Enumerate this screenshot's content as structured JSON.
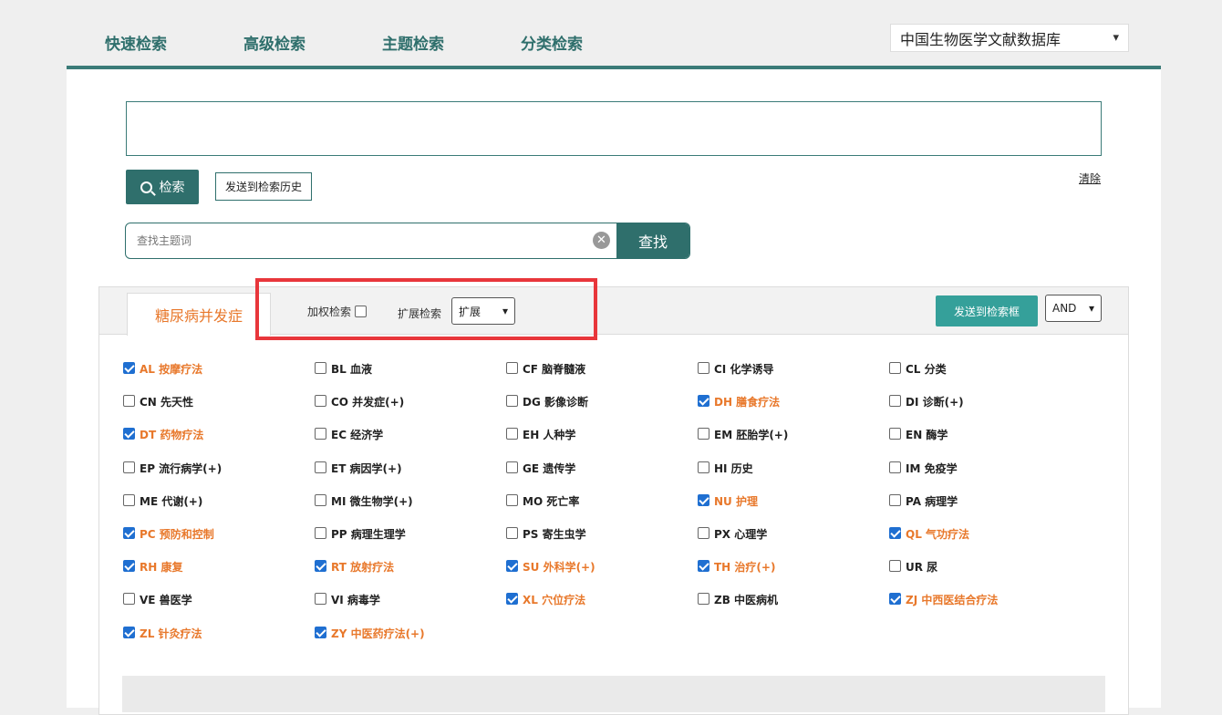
{
  "tabs": [
    {
      "label": "快速检索",
      "active": false
    },
    {
      "label": "高级检索",
      "active": false
    },
    {
      "label": "主题检索",
      "active": true
    },
    {
      "label": "分类检索",
      "active": false
    }
  ],
  "database_select": {
    "value": "中国生物医学文献数据库"
  },
  "query": {
    "search_label": "检索",
    "send_history_label": "发送到检索历史",
    "clear_label": "清除"
  },
  "find": {
    "placeholder": "查找主题词",
    "button_label": "查找"
  },
  "subject": {
    "tab_label": "糖尿病并发症",
    "weighted_label": "加权检索",
    "weighted_checked": false,
    "expand_label": "扩展检索",
    "expand_value": "扩展",
    "send_to_box_label": "发送到检索框",
    "logic_value": "AND"
  },
  "qualifiers": [
    {
      "label": "AL 按摩疗法",
      "checked": true
    },
    {
      "label": "BL 血液",
      "checked": false
    },
    {
      "label": "CF 脑脊髓液",
      "checked": false
    },
    {
      "label": "CI 化学诱导",
      "checked": false
    },
    {
      "label": "CL 分类",
      "checked": false
    },
    {
      "label": "CN 先天性",
      "checked": false
    },
    {
      "label": "CO 并发症(+)",
      "checked": false
    },
    {
      "label": "DG 影像诊断",
      "checked": false
    },
    {
      "label": "DH 膳食疗法",
      "checked": true
    },
    {
      "label": "DI 诊断(+)",
      "checked": false
    },
    {
      "label": "DT 药物疗法",
      "checked": true
    },
    {
      "label": "EC 经济学",
      "checked": false
    },
    {
      "label": "EH 人种学",
      "checked": false
    },
    {
      "label": "EM 胚胎学(+)",
      "checked": false
    },
    {
      "label": "EN 酶学",
      "checked": false
    },
    {
      "label": "EP 流行病学(+)",
      "checked": false
    },
    {
      "label": "ET 病因学(+)",
      "checked": false
    },
    {
      "label": "GE 遗传学",
      "checked": false
    },
    {
      "label": "HI 历史",
      "checked": false
    },
    {
      "label": "IM 免疫学",
      "checked": false
    },
    {
      "label": "ME 代谢(+)",
      "checked": false
    },
    {
      "label": "MI 微生物学(+)",
      "checked": false
    },
    {
      "label": "MO 死亡率",
      "checked": false
    },
    {
      "label": "NU 护理",
      "checked": true
    },
    {
      "label": "PA 病理学",
      "checked": false
    },
    {
      "label": "PC 预防和控制",
      "checked": true
    },
    {
      "label": "PP 病理生理学",
      "checked": false
    },
    {
      "label": "PS 寄生虫学",
      "checked": false
    },
    {
      "label": "PX 心理学",
      "checked": false
    },
    {
      "label": "QL 气功疗法",
      "checked": true
    },
    {
      "label": "RH 康复",
      "checked": true
    },
    {
      "label": "RT 放射疗法",
      "checked": true
    },
    {
      "label": "SU 外科学(+)",
      "checked": true
    },
    {
      "label": "TH 治疗(+)",
      "checked": true
    },
    {
      "label": "UR 尿",
      "checked": false
    },
    {
      "label": "VE 兽医学",
      "checked": false
    },
    {
      "label": "VI 病毒学",
      "checked": false
    },
    {
      "label": "XL 穴位疗法",
      "checked": true
    },
    {
      "label": "ZB 中医病机",
      "checked": false
    },
    {
      "label": "ZJ 中西医结合疗法",
      "checked": true
    },
    {
      "label": "ZL 针灸疗法",
      "checked": true
    },
    {
      "label": "ZY 中医药疗法(+)",
      "checked": true
    }
  ],
  "colors": {
    "primary": "#2f6f6c",
    "accent": "#e8782b",
    "send_button": "#35a09a",
    "highlight": "#e8363b",
    "checkbox_checked": "#1f6fd1"
  }
}
